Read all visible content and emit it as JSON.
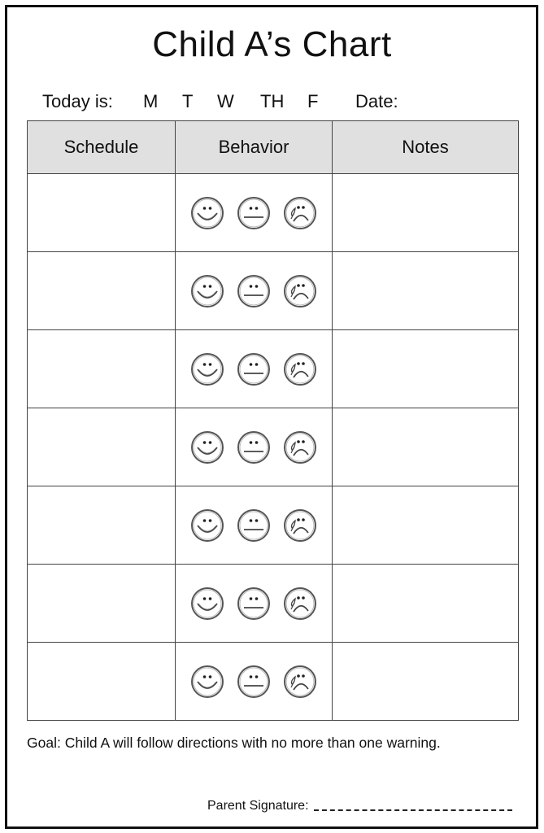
{
  "title": "Child A’s Chart",
  "today_label": "Today is:",
  "days": [
    "M",
    "T",
    "W",
    "TH",
    "F"
  ],
  "date_label": "Date:",
  "table": {
    "headers": [
      "Schedule",
      "Behavior",
      "Notes"
    ],
    "row_count": 7,
    "rows": [
      {
        "schedule": "",
        "notes": ""
      },
      {
        "schedule": "",
        "notes": ""
      },
      {
        "schedule": "",
        "notes": ""
      },
      {
        "schedule": "",
        "notes": ""
      },
      {
        "schedule": "",
        "notes": ""
      },
      {
        "schedule": "",
        "notes": ""
      },
      {
        "schedule": "",
        "notes": ""
      }
    ],
    "behavior_icons": [
      "happy-face-icon",
      "neutral-face-icon",
      "sad-face-icon"
    ]
  },
  "goal": "Goal: Child A will follow directions with no more than one warning.",
  "signature_label": "Parent Signature:",
  "colors": {
    "header_bg": "#e0e0e0",
    "border": "#111111",
    "grid": "#444444"
  }
}
